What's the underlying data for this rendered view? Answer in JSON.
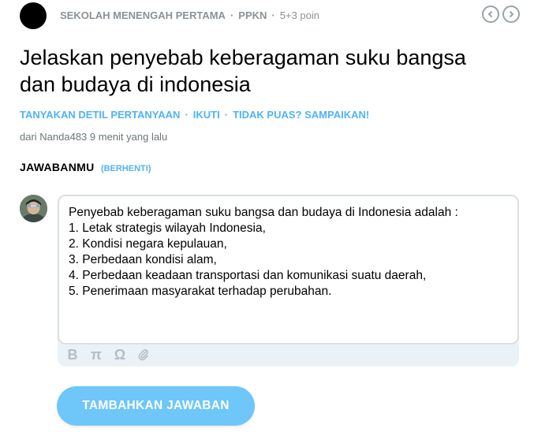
{
  "question": {
    "school_level": "SEKOLAH MENENGAH PERTAMA",
    "subject": "PPKN",
    "points": "5+3 poin",
    "title_line1": "Jelaskan penyebab keberagaman suku bangsa",
    "title_line2": "dan budaya di indonesia",
    "asker_info": "dari Nanda483 9 menit yang lalu"
  },
  "actions": {
    "details": "TANYAKAN DETIL PERTANYAAN",
    "follow": "IKUTI",
    "complain": "TIDAK PUAS? SAMPAIKAN!"
  },
  "answer": {
    "heading": "JAWABANMU",
    "stop_label": "(BERHENTI)",
    "lines": [
      "Penyebab keberagaman suku bangsa dan budaya di Indonesia adalah :",
      "1. Letak strategis wilayah Indonesia,",
      "2. Kondisi negara kepulauan,",
      "3. Perbedaan kondisi alam,",
      "4. Perbedaan keadaan transportasi dan komunikasi suatu daerah,",
      "5. Penerimaan masyarakat terhadap perubahan."
    ],
    "toolbar": {
      "bold": "B",
      "math": "π",
      "symbol": "Ω"
    },
    "submit_label": "TAMBAHKAN JAWABAN"
  },
  "colors": {
    "accent": "#4fb3f6",
    "button": "#6ec6f9",
    "meta_text": "#8a9297"
  },
  "icons": {
    "prev": "chevron-left-icon",
    "next": "chevron-right-icon",
    "attach": "paperclip-icon"
  }
}
